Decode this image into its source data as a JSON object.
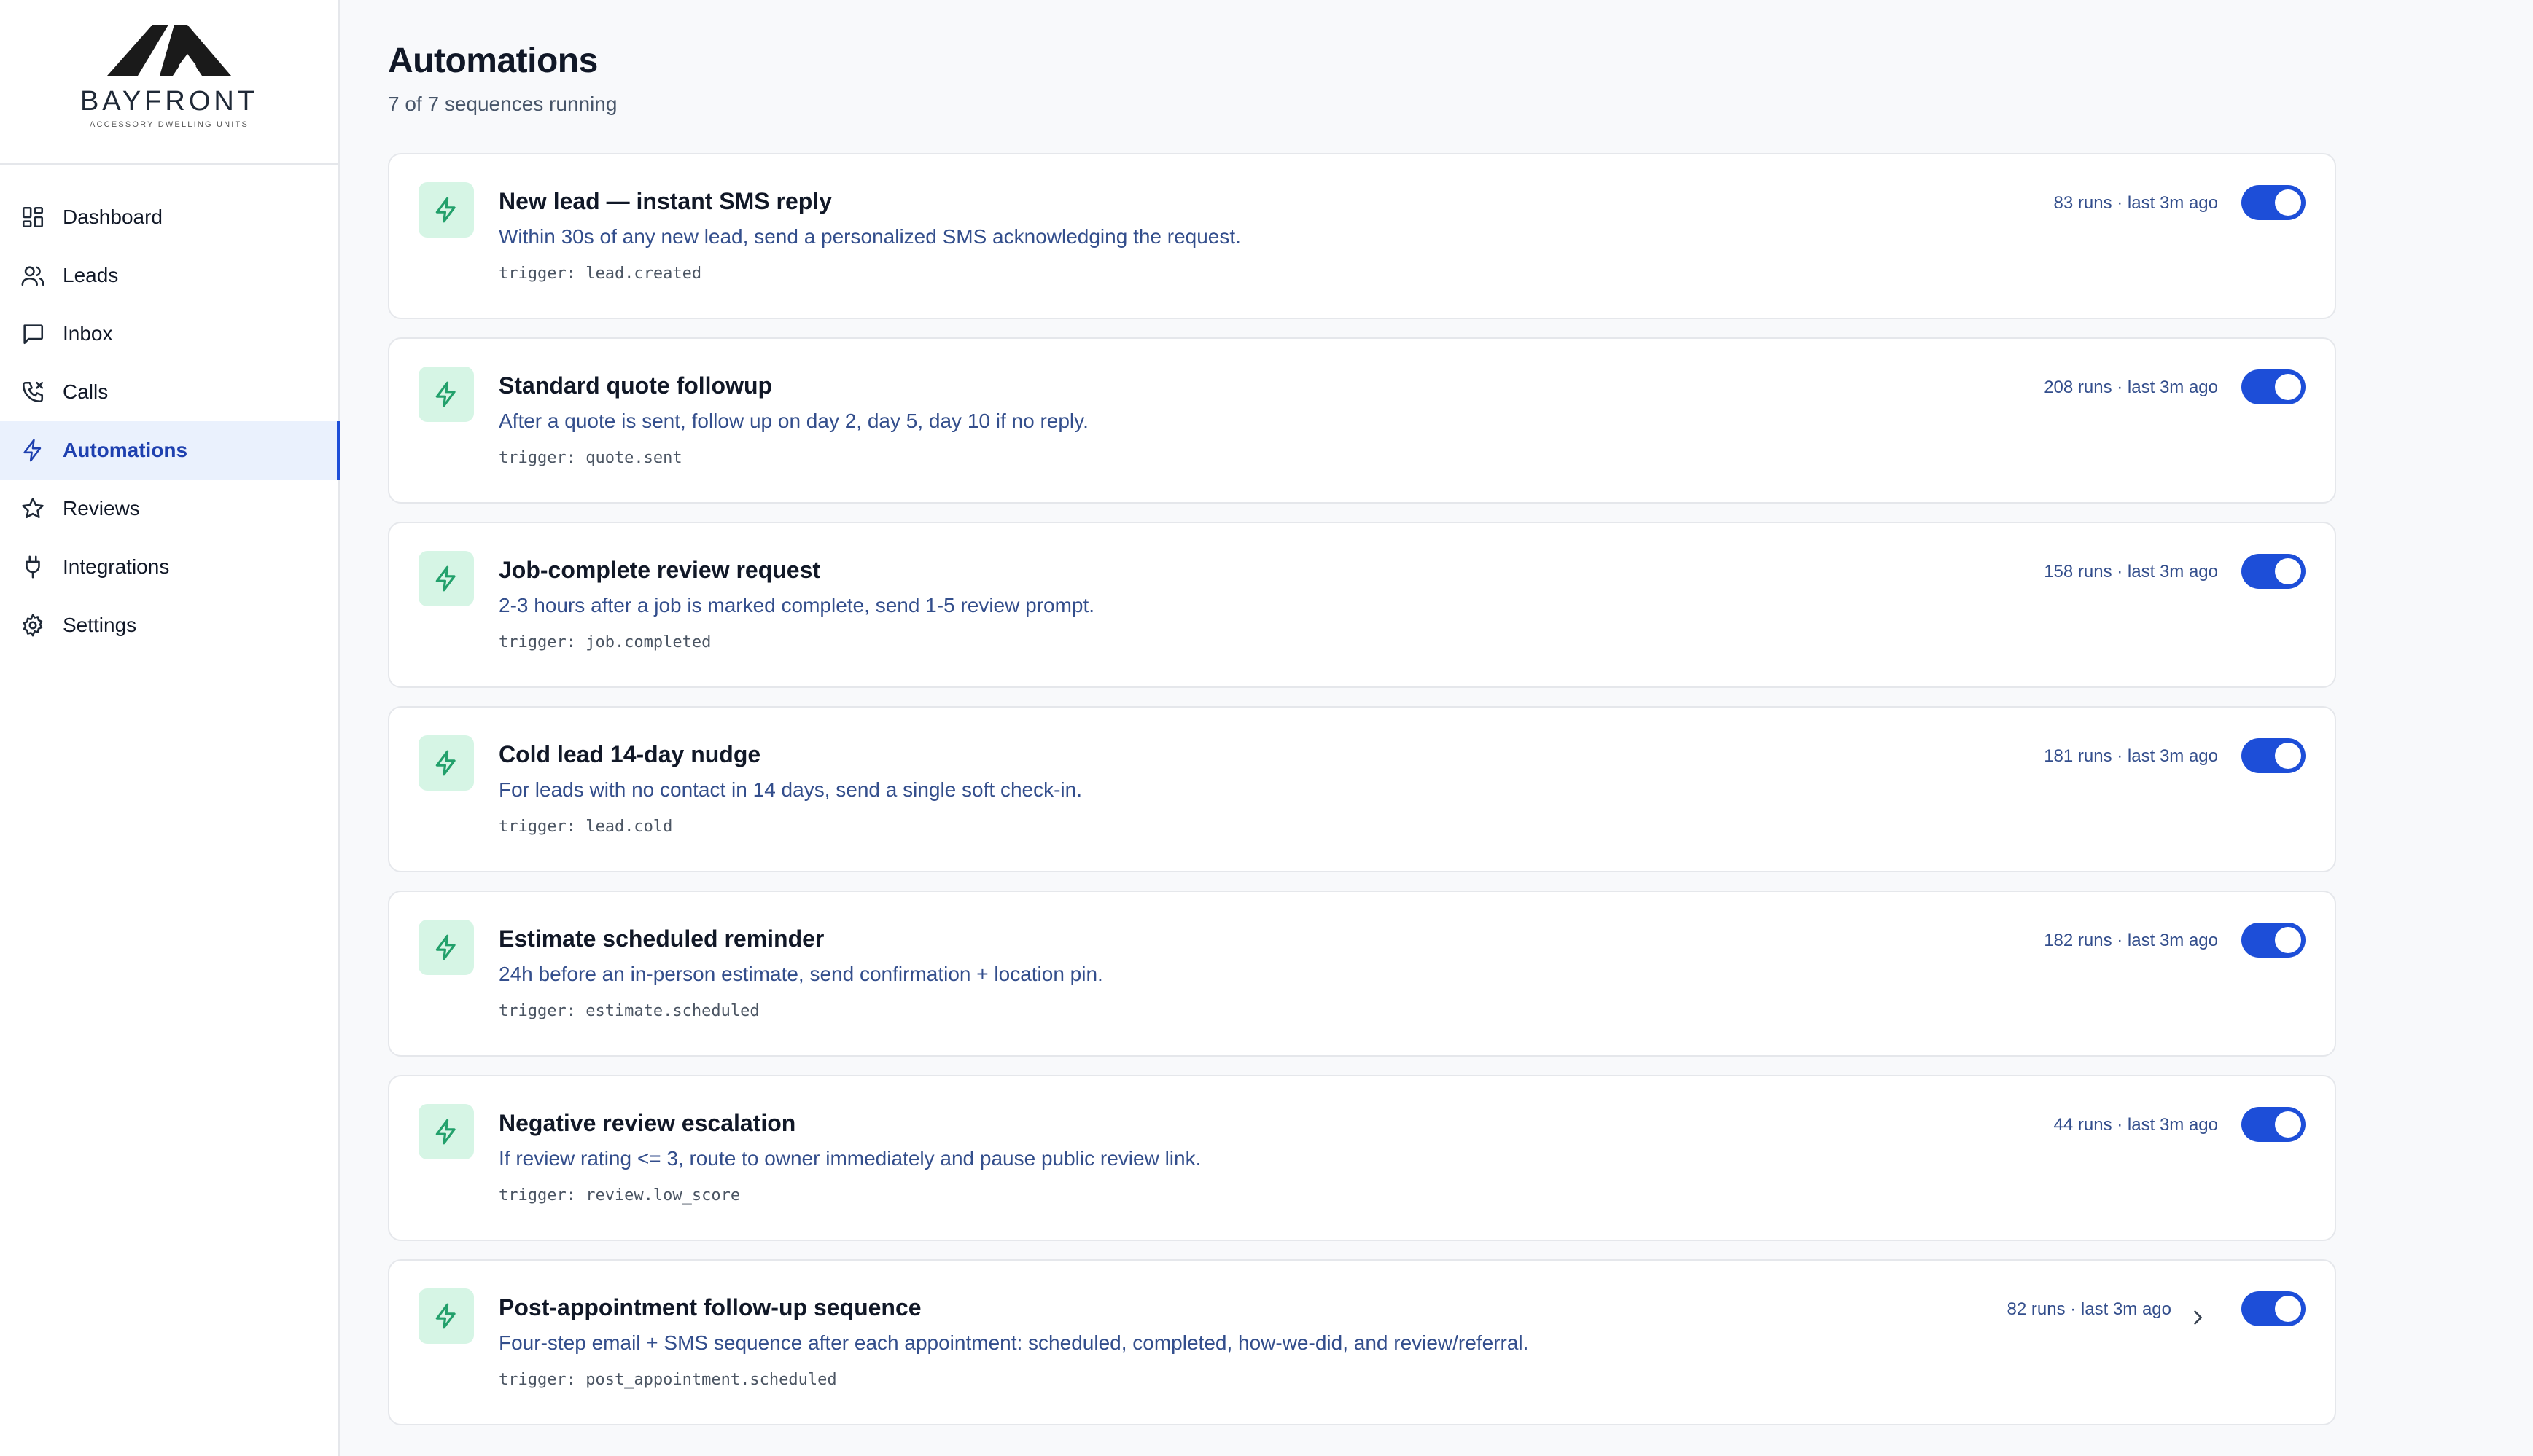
{
  "brand": {
    "name": "BAYFRONT",
    "tagline": "ACCESSORY DWELLING UNITS",
    "logo_icon": "roof-logo-icon"
  },
  "sidebar": {
    "items": [
      {
        "label": "Dashboard",
        "icon": "grid-icon",
        "active": false
      },
      {
        "label": "Leads",
        "icon": "users-icon",
        "active": false
      },
      {
        "label": "Inbox",
        "icon": "message-icon",
        "active": false
      },
      {
        "label": "Calls",
        "icon": "phone-icon",
        "active": false
      },
      {
        "label": "Automations",
        "icon": "bolt-icon",
        "active": true
      },
      {
        "label": "Reviews",
        "icon": "star-icon",
        "active": false
      },
      {
        "label": "Integrations",
        "icon": "plug-icon",
        "active": false
      },
      {
        "label": "Settings",
        "icon": "gear-icon",
        "active": false
      }
    ]
  },
  "page": {
    "title": "Automations",
    "subtitle": "7 of 7 sequences running"
  },
  "automations": [
    {
      "title": "New lead — instant SMS reply",
      "description": "Within 30s of any new lead, send a personalized SMS acknowledging the request.",
      "trigger": "trigger: lead.created",
      "meta": "83 runs · last 3m ago",
      "enabled": true
    },
    {
      "title": "Standard quote followup",
      "description": "After a quote is sent, follow up on day 2, day 5, day 10 if no reply.",
      "trigger": "trigger: quote.sent",
      "meta": "208 runs · last 3m ago",
      "enabled": true
    },
    {
      "title": "Job-complete review request",
      "description": "2-3 hours after a job is marked complete, send 1-5 review prompt.",
      "trigger": "trigger: job.completed",
      "meta": "158 runs · last 3m ago",
      "enabled": true
    },
    {
      "title": "Cold lead 14-day nudge",
      "description": "For leads with no contact in 14 days, send a single soft check-in.",
      "trigger": "trigger: lead.cold",
      "meta": "181 runs · last 3m ago",
      "enabled": true
    },
    {
      "title": "Estimate scheduled reminder",
      "description": "24h before an in-person estimate, send confirmation + location pin.",
      "trigger": "trigger: estimate.scheduled",
      "meta": "182 runs · last 3m ago",
      "enabled": true
    },
    {
      "title": "Negative review escalation",
      "description": "If review rating <= 3, route to owner immediately and pause public review link.",
      "trigger": "trigger: review.low_score",
      "meta": "44 runs · last 3m ago",
      "enabled": true
    },
    {
      "title": "Post-appointment follow-up sequence",
      "description": "Four-step email + SMS sequence after each appointment: scheduled, completed, how-we-did, and review/referral.",
      "trigger": "trigger: post_appointment.scheduled",
      "meta": "82 runs · last 3m ago",
      "enabled": true,
      "expandable": true
    }
  ],
  "colors": {
    "accent": "#1d4ed8",
    "active_bg": "#eaf1fd",
    "icon_tile_bg": "#d6f5e5",
    "icon_tile_fg": "#22a06b",
    "muted_text": "#334e8c"
  }
}
